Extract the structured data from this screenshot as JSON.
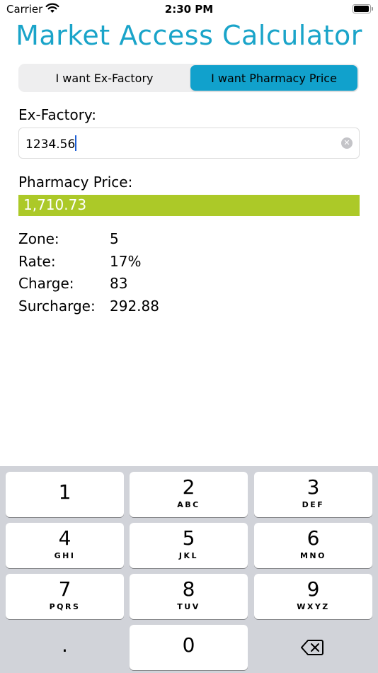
{
  "status_bar": {
    "carrier": "Carrier",
    "time": "2:30 PM"
  },
  "app": {
    "title": "Market Access Calculator"
  },
  "segmented": {
    "left_label": "I want Ex-Factory",
    "right_label": "I want Pharmacy Price",
    "selected": "right"
  },
  "ex_factory": {
    "label": "Ex-Factory:",
    "value": "1234.56"
  },
  "pharmacy": {
    "label": "Pharmacy Price:",
    "value": "1,710.73"
  },
  "details": [
    {
      "key": "Zone:",
      "value": "5"
    },
    {
      "key": "Rate:",
      "value": "17%"
    },
    {
      "key": "Charge:",
      "value": "83"
    },
    {
      "key": "Surcharge:",
      "value": "292.88"
    }
  ],
  "keypad": {
    "keys": [
      {
        "num": "1",
        "letters": ""
      },
      {
        "num": "2",
        "letters": "ABC"
      },
      {
        "num": "3",
        "letters": "DEF"
      },
      {
        "num": "4",
        "letters": "GHI"
      },
      {
        "num": "5",
        "letters": "JKL"
      },
      {
        "num": "6",
        "letters": "MNO"
      },
      {
        "num": "7",
        "letters": "PQRS"
      },
      {
        "num": "8",
        "letters": "TUV"
      },
      {
        "num": "9",
        "letters": "WXYZ"
      },
      {
        "num": ".",
        "letters": ""
      },
      {
        "num": "0",
        "letters": ""
      }
    ],
    "delete_icon": "backspace-icon"
  },
  "colors": {
    "title": "#1aa4c9",
    "segment_selected": "#11a1cc",
    "result_bar": "#acc928",
    "keyboard_bg": "#d1d3d9"
  }
}
